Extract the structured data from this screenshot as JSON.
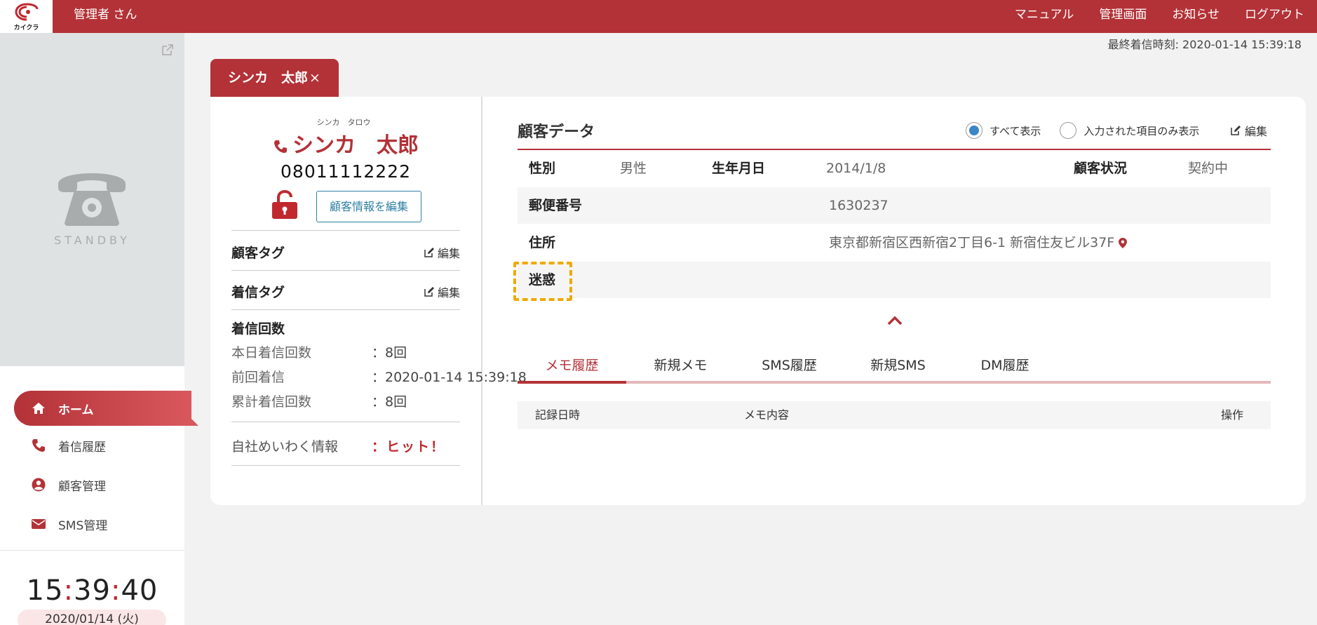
{
  "header": {
    "logo_text": "カイクラ",
    "user_name": "管理者 さん",
    "nav": [
      "マニュアル",
      "管理画面",
      "お知らせ",
      "ログアウト"
    ]
  },
  "last_call": "最終着信時刻: 2020-01-14 15:39:18",
  "sidebar": {
    "standby_label": "STANDBY",
    "menu": [
      {
        "label": "ホーム",
        "icon": "home-icon",
        "active": true
      },
      {
        "label": "着信履歴",
        "icon": "phone-icon"
      },
      {
        "label": "顧客管理",
        "icon": "user-circle-icon"
      },
      {
        "label": "SMS管理",
        "icon": "mail-icon"
      }
    ],
    "clock": {
      "h": "15",
      "m": "39",
      "s": "40",
      "sep": ":"
    },
    "date": "2020/01/14 (火)"
  },
  "tab": {
    "label": "シンカ　太郎",
    "close": "×"
  },
  "customer": {
    "ruby": "シンカ　タロウ",
    "name": "シンカ　太郎",
    "phone": "08011112222",
    "edit_button": "顧客情報を編集",
    "tag_label": "顧客タグ",
    "call_tag_label": "着信タグ",
    "edit_label": "編集",
    "count_title": "着信回数",
    "counts": [
      {
        "label": "本日着信回数",
        "value": "：8回"
      },
      {
        "label": "前回着信",
        "value": "：2020-01-14 15:39:18"
      },
      {
        "label": "累計着信回数",
        "value": "：8回"
      }
    ],
    "spam_label": "自社めいわく情報",
    "spam_value": "：ヒット！"
  },
  "customer_data": {
    "title": "顧客データ",
    "radio_all": "すべて表示",
    "radio_filled": "入力された項目のみ表示",
    "edit_label": "編集",
    "gender_key": "性別",
    "gender_val": "男性",
    "birth_key": "生年月日",
    "birth_val": "2014/1/8",
    "status_key": "顧客状況",
    "status_val": "契約中",
    "zip_key": "郵便番号",
    "zip_val": "1630237",
    "addr_key": "住所",
    "addr_val": "東京都新宿区西新宿2丁目6-1 新宿住友ビル37F",
    "spam_key": "迷惑"
  },
  "history_tabs": [
    "メモ履歴",
    "新規メモ",
    "SMS履歴",
    "新規SMS",
    "DM履歴"
  ],
  "memo_table": {
    "col_date": "記録日時",
    "col_content": "メモ内容",
    "col_action": "操作"
  },
  "colors": {
    "brand": "#b33237",
    "accent_blue": "#3b86c4",
    "highlight": "#f0a800"
  }
}
